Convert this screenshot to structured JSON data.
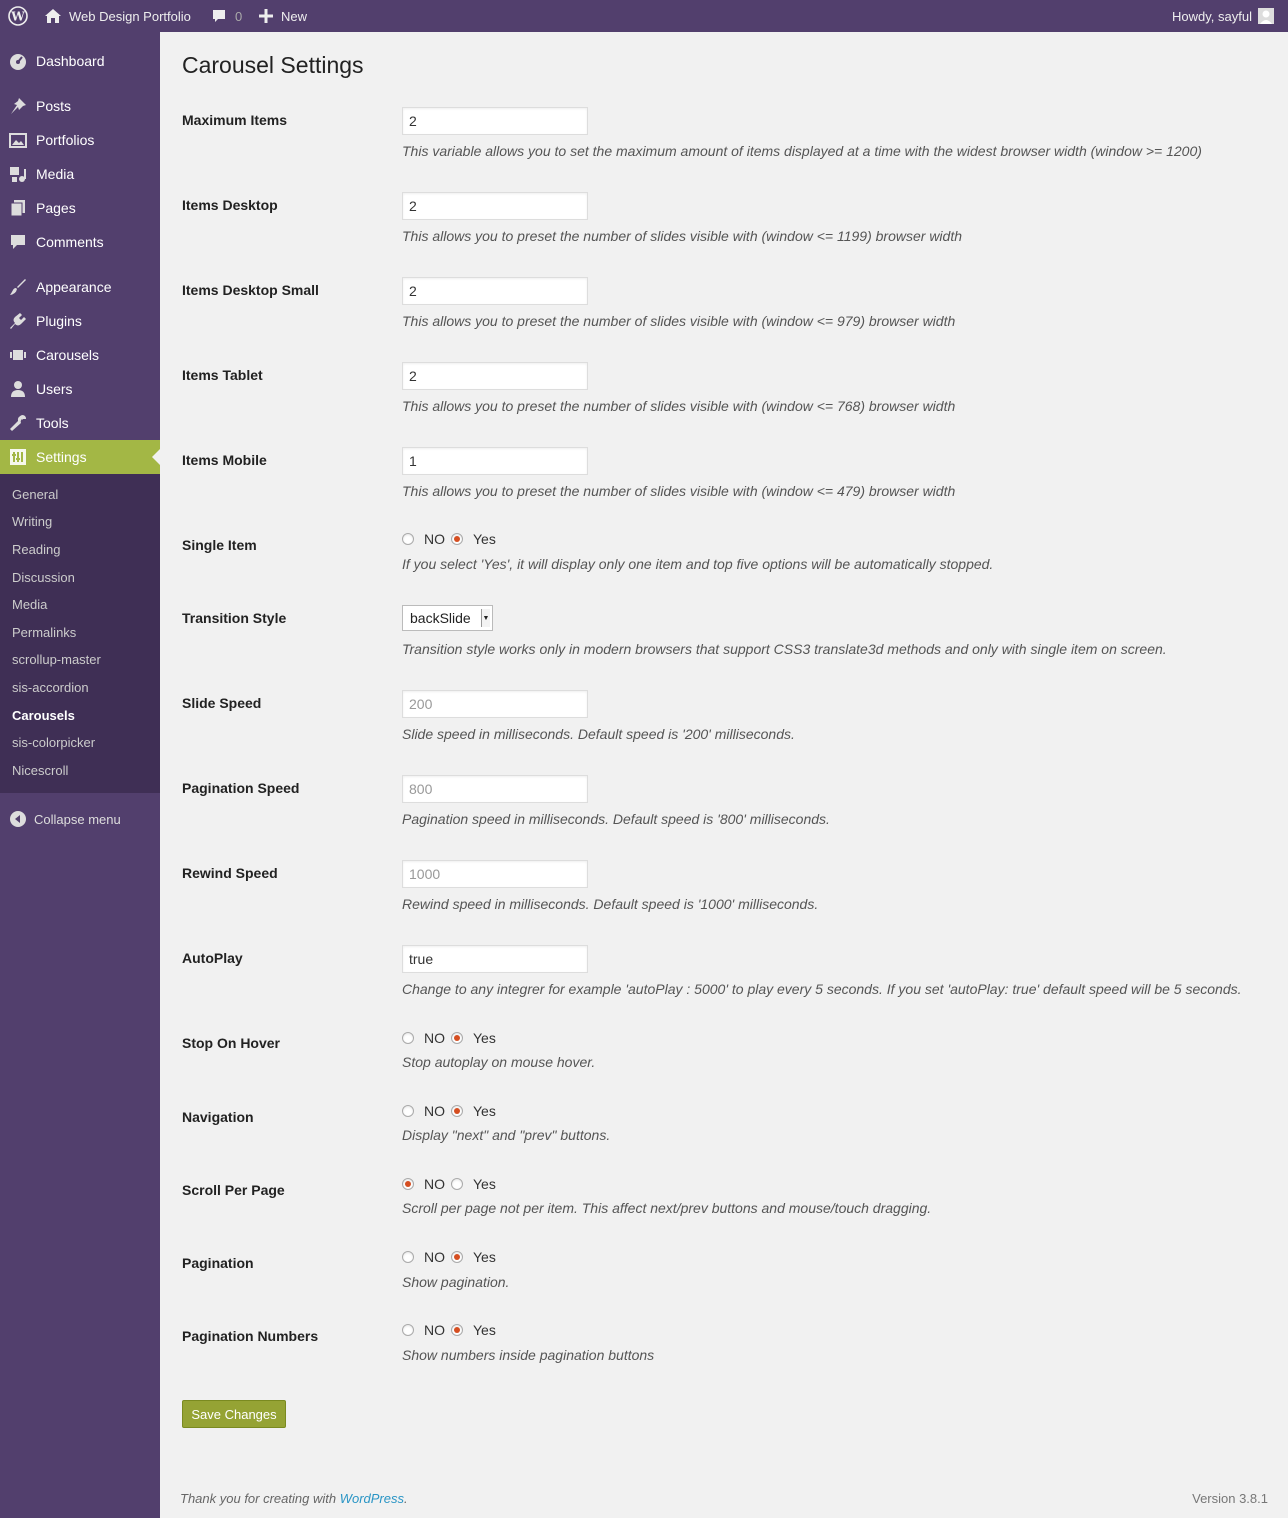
{
  "adminbar": {
    "site_name": "Web Design Portfolio",
    "comments_count": "0",
    "new_label": "New",
    "howdy": "Howdy, sayful"
  },
  "sidebar": {
    "items": [
      {
        "label": "Dashboard",
        "icon": "dashboard-icon"
      },
      {
        "label": "Posts",
        "icon": "pin-icon"
      },
      {
        "label": "Portfolios",
        "icon": "portfolio-icon"
      },
      {
        "label": "Media",
        "icon": "media-icon"
      },
      {
        "label": "Pages",
        "icon": "pages-icon"
      },
      {
        "label": "Comments",
        "icon": "comments-icon"
      },
      {
        "label": "Appearance",
        "icon": "appearance-icon"
      },
      {
        "label": "Plugins",
        "icon": "plugins-icon"
      },
      {
        "label": "Carousels",
        "icon": "carousel-icon"
      },
      {
        "label": "Users",
        "icon": "users-icon"
      },
      {
        "label": "Tools",
        "icon": "tools-icon"
      },
      {
        "label": "Settings",
        "icon": "settings-icon"
      }
    ],
    "submenu": [
      "General",
      "Writing",
      "Reading",
      "Discussion",
      "Media",
      "Permalinks",
      "scrollup-master",
      "sis-accordion",
      "Carousels",
      "sis-colorpicker",
      "Nicescroll"
    ],
    "collapse_label": "Collapse menu"
  },
  "page": {
    "title": "Carousel Settings",
    "fields": {
      "max_items": {
        "label": "Maximum Items",
        "value": "2",
        "desc": "This variable allows you to set the maximum amount of items displayed at a time with the widest browser width (window >= 1200)"
      },
      "items_desktop": {
        "label": "Items Desktop",
        "value": "2",
        "desc": "This allows you to preset the number of slides visible with (window <= 1199) browser width"
      },
      "items_desktop_small": {
        "label": "Items Desktop Small",
        "value": "2",
        "desc": "This allows you to preset the number of slides visible with (window <= 979) browser width"
      },
      "items_tablet": {
        "label": "Items Tablet",
        "value": "2",
        "desc": "This allows you to preset the number of slides visible with (window <= 768) browser width"
      },
      "items_mobile": {
        "label": "Items Mobile",
        "value": "1",
        "desc": "This allows you to preset the number of slides visible with (window <= 479) browser width"
      },
      "single_item": {
        "label": "Single Item",
        "selected": "Yes",
        "desc": "If you select 'Yes', it will display only one item and top five options will be automatically stopped."
      },
      "transition_style": {
        "label": "Transition Style",
        "value": "backSlide",
        "desc": "Transition style works only in modern browsers that support CSS3 translate3d methods and only with single item on screen."
      },
      "slide_speed": {
        "label": "Slide Speed",
        "placeholder": "200",
        "desc": "Slide speed in milliseconds. Default speed is '200' milliseconds."
      },
      "pagination_speed": {
        "label": "Pagination Speed",
        "placeholder": "800",
        "desc": "Pagination speed in milliseconds. Default speed is '800' milliseconds."
      },
      "rewind_speed": {
        "label": "Rewind Speed",
        "placeholder": "1000",
        "desc": "Rewind speed in milliseconds. Default speed is '1000' milliseconds."
      },
      "autoplay": {
        "label": "AutoPlay",
        "value": "true",
        "desc": "Change to any integrer for example 'autoPlay : 5000' to play every 5 seconds. If you set 'autoPlay: true' default speed will be 5 seconds."
      },
      "stop_on_hover": {
        "label": "Stop On Hover",
        "selected": "Yes",
        "desc": "Stop autoplay on mouse hover."
      },
      "navigation": {
        "label": "Navigation",
        "selected": "Yes",
        "desc": "Display \"next\" and \"prev\" buttons."
      },
      "scroll_per_page": {
        "label": "Scroll Per Page",
        "selected": "NO",
        "desc": "Scroll per page not per item. This affect next/prev buttons and mouse/touch dragging."
      },
      "pagination": {
        "label": "Pagination",
        "selected": "Yes",
        "desc": "Show pagination."
      },
      "pagination_numbers": {
        "label": "Pagination Numbers",
        "selected": "Yes",
        "desc": "Show numbers inside pagination buttons"
      }
    },
    "radio_no": "NO",
    "radio_yes": "Yes",
    "save_label": "Save Changes"
  },
  "footer": {
    "thanks_prefix": "Thank you for creating with ",
    "wp_link": "WordPress",
    "thanks_suffix": ".",
    "version": "Version 3.8.1"
  },
  "colors": {
    "sidebar_bg": "#523f6d",
    "submenu_bg": "#3f2f55",
    "current_bg": "#a3b745",
    "accent": "#d54e21"
  }
}
